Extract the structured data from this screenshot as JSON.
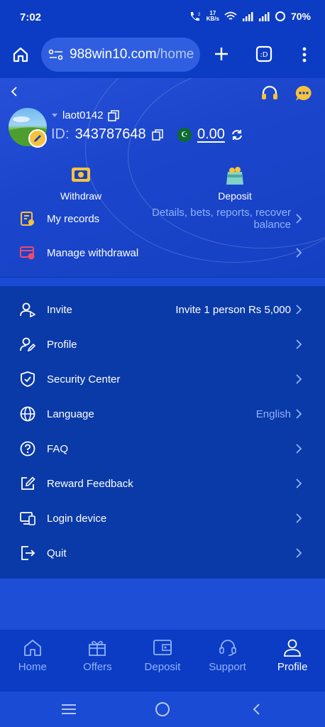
{
  "status": {
    "time": "7:02",
    "speed_value": "17",
    "speed_unit": "KB/s",
    "battery": "70%"
  },
  "browser": {
    "url_host": "988win10.com",
    "url_path": "/home"
  },
  "user": {
    "username": "laot0142",
    "id_label": "ID:",
    "id_value": "343787648",
    "balance": "0.00"
  },
  "quick_actions": {
    "withdraw": "Withdraw",
    "deposit": "Deposit"
  },
  "records": {
    "label": "My records",
    "value_line1": "Details, bets, reports, recover",
    "value_line2": "balance"
  },
  "manage_withdrawal": {
    "label": "Manage withdrawal"
  },
  "menu": [
    {
      "key": "invite",
      "label": "Invite",
      "value": "Invite 1 person Rs 5,000"
    },
    {
      "key": "profile",
      "label": "Profile",
      "value": ""
    },
    {
      "key": "security",
      "label": "Security Center",
      "value": ""
    },
    {
      "key": "language",
      "label": "Language",
      "value": "English"
    },
    {
      "key": "faq",
      "label": "FAQ",
      "value": ""
    },
    {
      "key": "feedback",
      "label": "Reward Feedback",
      "value": ""
    },
    {
      "key": "device",
      "label": "Login device",
      "value": ""
    },
    {
      "key": "quit",
      "label": "Quit",
      "value": ""
    }
  ],
  "tabs": [
    {
      "label": "Home"
    },
    {
      "label": "Offers"
    },
    {
      "label": "Deposit"
    },
    {
      "label": "Support"
    },
    {
      "label": "Profile"
    }
  ],
  "colors": {
    "accent": "#f7c23c",
    "link": "#8fb2ff",
    "bg": "#0a3aa8"
  }
}
